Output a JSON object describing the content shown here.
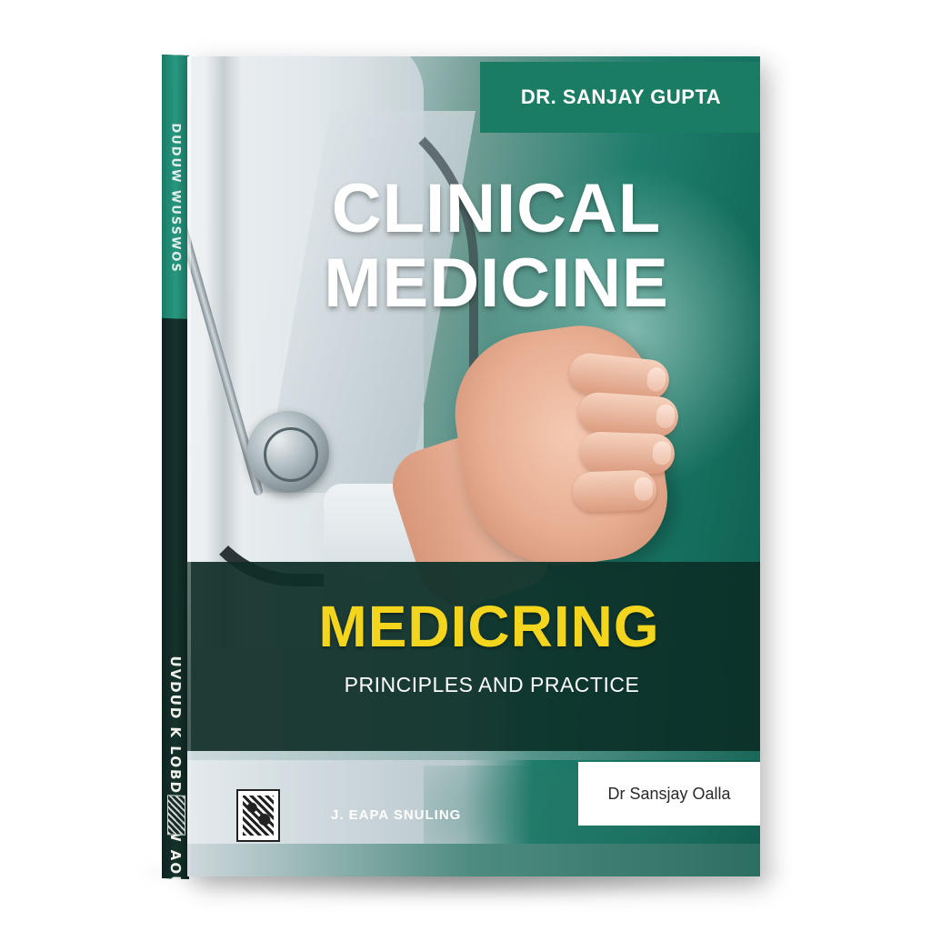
{
  "book": {
    "author_banner": "DR. SANJAY GUPTA",
    "title_line1": "CLINICAL",
    "title_line2": "MEDICINE",
    "subtitle_main": "MEDICRING",
    "subtitle_sub": "PRINCIPLES AND PRACTICE",
    "publisher_name": "J. EAPA SNULING",
    "author_plate": "Dr Sansjay Oalla",
    "spine_text_top": "DUDUW WUSSWOS",
    "spine_text_bottom": "UVDUD K LOBDINAW AOUUIW"
  },
  "colors": {
    "banner_green": "#1a7c63",
    "subtitle_yellow": "#f3d51d",
    "band_dark": "#102c26",
    "background": "#ffffff"
  },
  "icons": {
    "publisher_logo": "publisher-logo-icon"
  }
}
